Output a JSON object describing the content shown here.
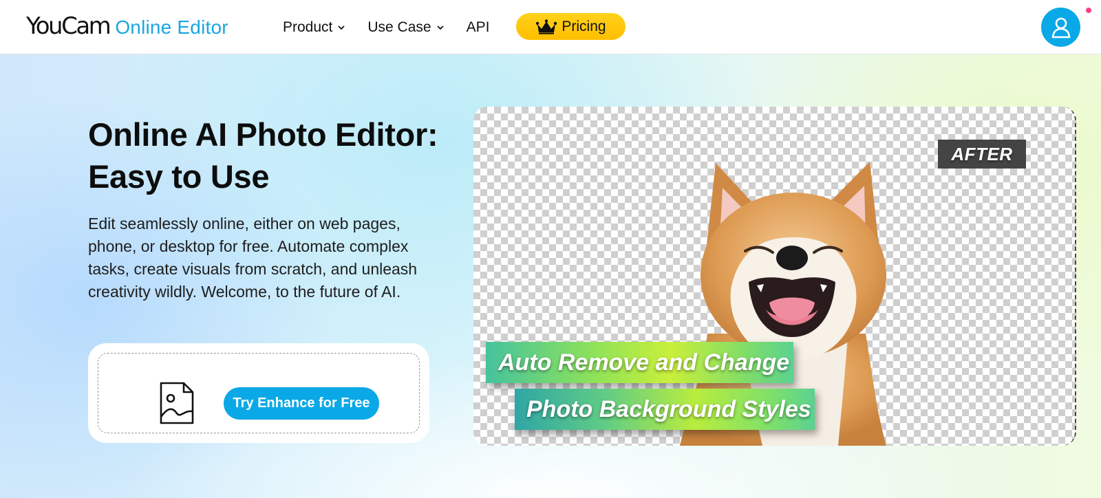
{
  "header": {
    "logo": {
      "main": "YouCam",
      "sub": "Online Editor"
    },
    "nav": [
      {
        "label": "Product",
        "has_dropdown": true
      },
      {
        "label": "Use Case",
        "has_dropdown": true
      },
      {
        "label": "API",
        "has_dropdown": false
      }
    ],
    "pricing_label": "Pricing",
    "avatar_icon": "user-icon"
  },
  "hero": {
    "title": "Online AI Photo Editor: Easy to Use",
    "description": "Edit seamlessly online, either on web pages, phone, or desktop for free. Automate complex tasks, create visuals from scratch, and unleash creativity wildly. Welcome, to the future of AI.",
    "cta_label": "Try Enhance for Free",
    "upload_icon": "image-file-icon"
  },
  "preview": {
    "badge": "AFTER",
    "caption_line1": "Auto Remove and Change",
    "caption_line2": "Photo Background Styles"
  },
  "colors": {
    "accent": "#0aa8e6",
    "pricing": "#ffc400",
    "notification": "#ff3d8b"
  }
}
